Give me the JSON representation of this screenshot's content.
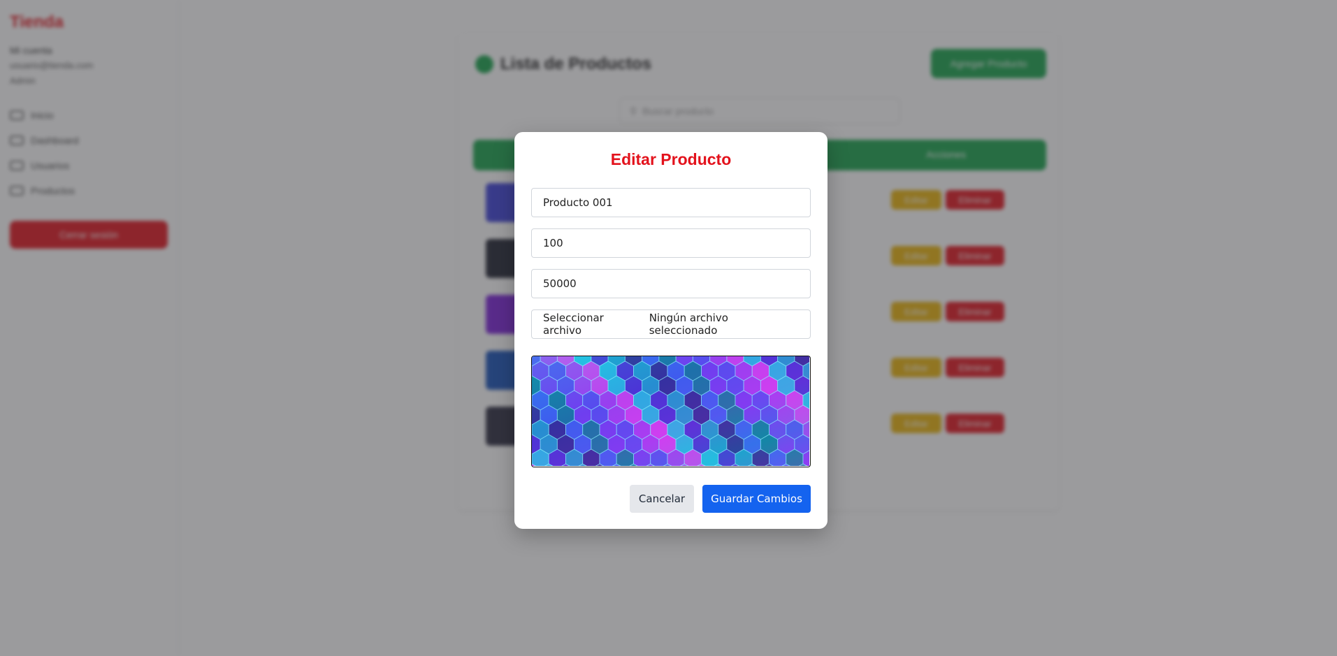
{
  "app": {
    "logo": "Tienda",
    "user": {
      "name": "Mi cuenta",
      "email": "usuario@tienda.com",
      "role": "Admin"
    },
    "nav": [
      {
        "label": "Inicio",
        "icon": "home-icon"
      },
      {
        "label": "Dashboard",
        "icon": "dashboard-icon"
      },
      {
        "label": "Usuarios",
        "icon": "users-icon"
      },
      {
        "label": "Productos",
        "icon": "box-icon"
      }
    ],
    "logout_label": "Cerrar sesión",
    "page_title": "Lista de Productos",
    "add_button": "Agregar Producto",
    "search_placeholder": "Buscar producto",
    "table_actions_header": "Acciones",
    "row_edit_label": "Editar",
    "row_delete_label": "Eliminar",
    "row_thumb_colors": [
      "#3b3fd8",
      "#1f2230",
      "#7a1fd8",
      "#1550b8",
      "#2a2a3e"
    ]
  },
  "modal": {
    "title": "Editar Producto",
    "name_value": "Producto 001",
    "stock_value": "100",
    "price_value": "50000",
    "file_button_label": "Seleccionar archivo",
    "file_status": "Ningún archivo seleccionado",
    "image_alt": "hexagon pattern",
    "cancel_label": "Cancelar",
    "save_label": "Guardar Cambios"
  },
  "colors": {
    "accent_red": "#e3121c",
    "primary_blue": "#1463ef",
    "success_green": "#16a34a",
    "warning_yellow": "#eab308"
  }
}
